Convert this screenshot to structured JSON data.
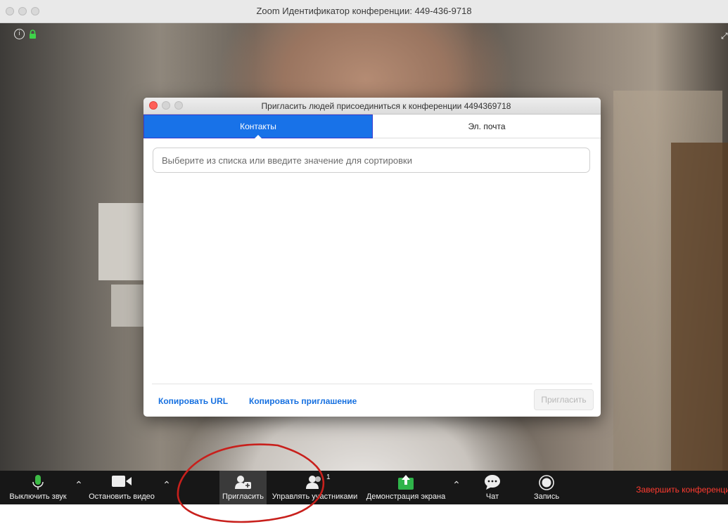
{
  "window": {
    "title": "Zoom Идентификатор конференции: 449-436-9718"
  },
  "dialog": {
    "title": "Пригласить людей присоединиться к конференции 4494369718",
    "tabs": [
      {
        "label": "Контакты",
        "active": true
      },
      {
        "label": "Эл. почта",
        "active": false
      }
    ],
    "search_placeholder": "Выберите из списка или введите значение для сортировки",
    "copy_url_label": "Копировать URL",
    "copy_invitation_label": "Копировать приглашение",
    "invite_button_label": "Пригласить"
  },
  "toolbar": {
    "mute_label": "Выключить звук",
    "stop_video_label": "Остановить видео",
    "invite_label": "Пригласить",
    "manage_participants_label": "Управлять участниками",
    "participants_count": "1",
    "share_screen_label": "Демонстрация экрана",
    "chat_label": "Чат",
    "record_label": "Запись",
    "end_meeting_label": "Завершить конференцию"
  },
  "colors": {
    "accent_blue": "#1872e8",
    "link_blue": "#1670e0",
    "end_red": "#ff3b30",
    "share_green": "#2fb44a",
    "annotation_red": "#c8201c"
  }
}
